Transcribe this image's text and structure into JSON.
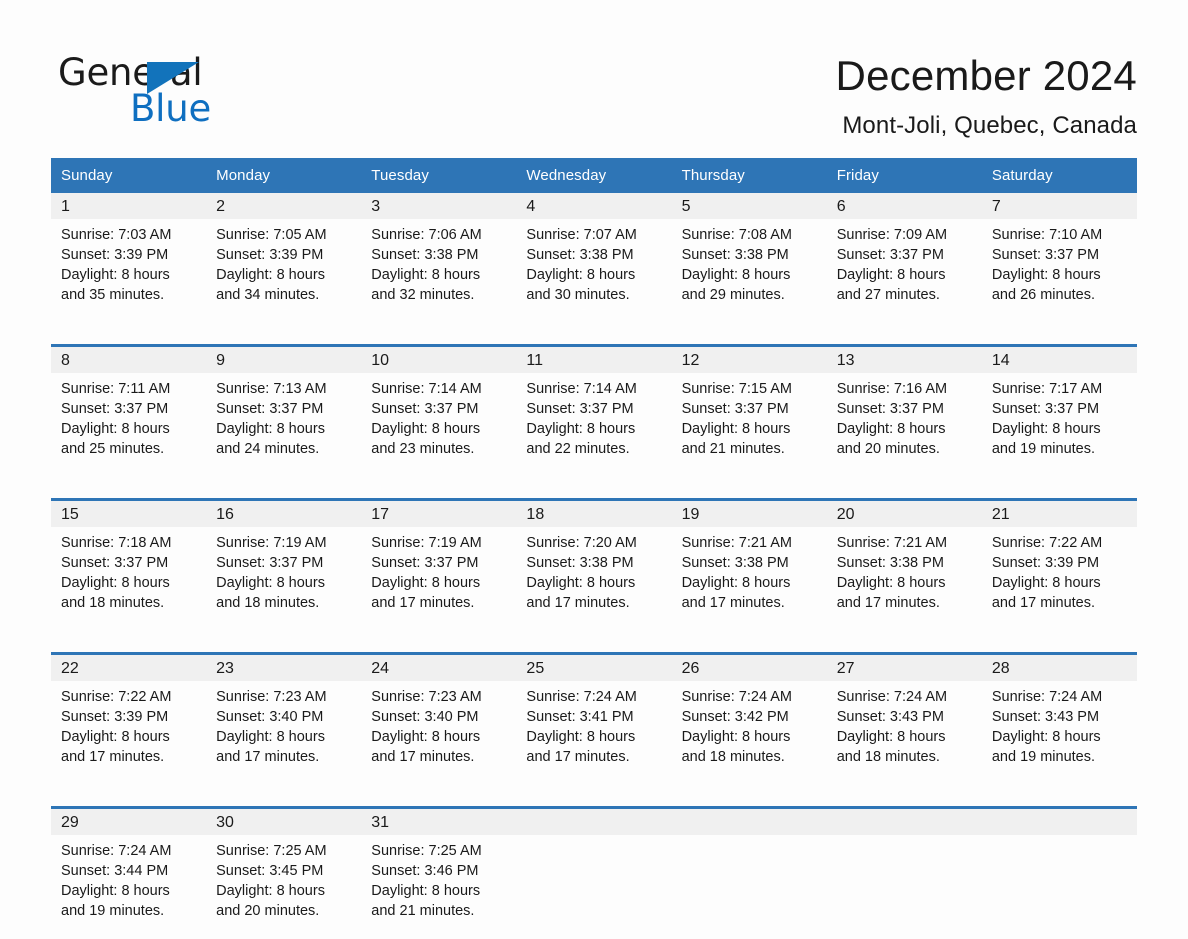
{
  "brand": {
    "name_part1": "General",
    "name_part2": "Blue"
  },
  "header": {
    "month_title": "December 2024",
    "location": "Mont-Joli, Quebec, Canada"
  },
  "colors": {
    "header_blue": "#2e75b6",
    "logo_blue": "#0f6fc0",
    "daynum_band": "#f0f0f0",
    "page_background": "#fdfdfd",
    "text": "#1a1a1a"
  },
  "calendar": {
    "weekday_headers": [
      "Sunday",
      "Monday",
      "Tuesday",
      "Wednesday",
      "Thursday",
      "Friday",
      "Saturday"
    ],
    "weeks": [
      [
        {
          "day": "1",
          "sunrise": "Sunrise: 7:03 AM",
          "sunset": "Sunset: 3:39 PM",
          "daylight_line1": "Daylight: 8 hours",
          "daylight_line2": "and 35 minutes."
        },
        {
          "day": "2",
          "sunrise": "Sunrise: 7:05 AM",
          "sunset": "Sunset: 3:39 PM",
          "daylight_line1": "Daylight: 8 hours",
          "daylight_line2": "and 34 minutes."
        },
        {
          "day": "3",
          "sunrise": "Sunrise: 7:06 AM",
          "sunset": "Sunset: 3:38 PM",
          "daylight_line1": "Daylight: 8 hours",
          "daylight_line2": "and 32 minutes."
        },
        {
          "day": "4",
          "sunrise": "Sunrise: 7:07 AM",
          "sunset": "Sunset: 3:38 PM",
          "daylight_line1": "Daylight: 8 hours",
          "daylight_line2": "and 30 minutes."
        },
        {
          "day": "5",
          "sunrise": "Sunrise: 7:08 AM",
          "sunset": "Sunset: 3:38 PM",
          "daylight_line1": "Daylight: 8 hours",
          "daylight_line2": "and 29 minutes."
        },
        {
          "day": "6",
          "sunrise": "Sunrise: 7:09 AM",
          "sunset": "Sunset: 3:37 PM",
          "daylight_line1": "Daylight: 8 hours",
          "daylight_line2": "and 27 minutes."
        },
        {
          "day": "7",
          "sunrise": "Sunrise: 7:10 AM",
          "sunset": "Sunset: 3:37 PM",
          "daylight_line1": "Daylight: 8 hours",
          "daylight_line2": "and 26 minutes."
        }
      ],
      [
        {
          "day": "8",
          "sunrise": "Sunrise: 7:11 AM",
          "sunset": "Sunset: 3:37 PM",
          "daylight_line1": "Daylight: 8 hours",
          "daylight_line2": "and 25 minutes."
        },
        {
          "day": "9",
          "sunrise": "Sunrise: 7:13 AM",
          "sunset": "Sunset: 3:37 PM",
          "daylight_line1": "Daylight: 8 hours",
          "daylight_line2": "and 24 minutes."
        },
        {
          "day": "10",
          "sunrise": "Sunrise: 7:14 AM",
          "sunset": "Sunset: 3:37 PM",
          "daylight_line1": "Daylight: 8 hours",
          "daylight_line2": "and 23 minutes."
        },
        {
          "day": "11",
          "sunrise": "Sunrise: 7:14 AM",
          "sunset": "Sunset: 3:37 PM",
          "daylight_line1": "Daylight: 8 hours",
          "daylight_line2": "and 22 minutes."
        },
        {
          "day": "12",
          "sunrise": "Sunrise: 7:15 AM",
          "sunset": "Sunset: 3:37 PM",
          "daylight_line1": "Daylight: 8 hours",
          "daylight_line2": "and 21 minutes."
        },
        {
          "day": "13",
          "sunrise": "Sunrise: 7:16 AM",
          "sunset": "Sunset: 3:37 PM",
          "daylight_line1": "Daylight: 8 hours",
          "daylight_line2": "and 20 minutes."
        },
        {
          "day": "14",
          "sunrise": "Sunrise: 7:17 AM",
          "sunset": "Sunset: 3:37 PM",
          "daylight_line1": "Daylight: 8 hours",
          "daylight_line2": "and 19 minutes."
        }
      ],
      [
        {
          "day": "15",
          "sunrise": "Sunrise: 7:18 AM",
          "sunset": "Sunset: 3:37 PM",
          "daylight_line1": "Daylight: 8 hours",
          "daylight_line2": "and 18 minutes."
        },
        {
          "day": "16",
          "sunrise": "Sunrise: 7:19 AM",
          "sunset": "Sunset: 3:37 PM",
          "daylight_line1": "Daylight: 8 hours",
          "daylight_line2": "and 18 minutes."
        },
        {
          "day": "17",
          "sunrise": "Sunrise: 7:19 AM",
          "sunset": "Sunset: 3:37 PM",
          "daylight_line1": "Daylight: 8 hours",
          "daylight_line2": "and 17 minutes."
        },
        {
          "day": "18",
          "sunrise": "Sunrise: 7:20 AM",
          "sunset": "Sunset: 3:38 PM",
          "daylight_line1": "Daylight: 8 hours",
          "daylight_line2": "and 17 minutes."
        },
        {
          "day": "19",
          "sunrise": "Sunrise: 7:21 AM",
          "sunset": "Sunset: 3:38 PM",
          "daylight_line1": "Daylight: 8 hours",
          "daylight_line2": "and 17 minutes."
        },
        {
          "day": "20",
          "sunrise": "Sunrise: 7:21 AM",
          "sunset": "Sunset: 3:38 PM",
          "daylight_line1": "Daylight: 8 hours",
          "daylight_line2": "and 17 minutes."
        },
        {
          "day": "21",
          "sunrise": "Sunrise: 7:22 AM",
          "sunset": "Sunset: 3:39 PM",
          "daylight_line1": "Daylight: 8 hours",
          "daylight_line2": "and 17 minutes."
        }
      ],
      [
        {
          "day": "22",
          "sunrise": "Sunrise: 7:22 AM",
          "sunset": "Sunset: 3:39 PM",
          "daylight_line1": "Daylight: 8 hours",
          "daylight_line2": "and 17 minutes."
        },
        {
          "day": "23",
          "sunrise": "Sunrise: 7:23 AM",
          "sunset": "Sunset: 3:40 PM",
          "daylight_line1": "Daylight: 8 hours",
          "daylight_line2": "and 17 minutes."
        },
        {
          "day": "24",
          "sunrise": "Sunrise: 7:23 AM",
          "sunset": "Sunset: 3:40 PM",
          "daylight_line1": "Daylight: 8 hours",
          "daylight_line2": "and 17 minutes."
        },
        {
          "day": "25",
          "sunrise": "Sunrise: 7:24 AM",
          "sunset": "Sunset: 3:41 PM",
          "daylight_line1": "Daylight: 8 hours",
          "daylight_line2": "and 17 minutes."
        },
        {
          "day": "26",
          "sunrise": "Sunrise: 7:24 AM",
          "sunset": "Sunset: 3:42 PM",
          "daylight_line1": "Daylight: 8 hours",
          "daylight_line2": "and 18 minutes."
        },
        {
          "day": "27",
          "sunrise": "Sunrise: 7:24 AM",
          "sunset": "Sunset: 3:43 PM",
          "daylight_line1": "Daylight: 8 hours",
          "daylight_line2": "and 18 minutes."
        },
        {
          "day": "28",
          "sunrise": "Sunrise: 7:24 AM",
          "sunset": "Sunset: 3:43 PM",
          "daylight_line1": "Daylight: 8 hours",
          "daylight_line2": "and 19 minutes."
        }
      ],
      [
        {
          "day": "29",
          "sunrise": "Sunrise: 7:24 AM",
          "sunset": "Sunset: 3:44 PM",
          "daylight_line1": "Daylight: 8 hours",
          "daylight_line2": "and 19 minutes."
        },
        {
          "day": "30",
          "sunrise": "Sunrise: 7:25 AM",
          "sunset": "Sunset: 3:45 PM",
          "daylight_line1": "Daylight: 8 hours",
          "daylight_line2": "and 20 minutes."
        },
        {
          "day": "31",
          "sunrise": "Sunrise: 7:25 AM",
          "sunset": "Sunset: 3:46 PM",
          "daylight_line1": "Daylight: 8 hours",
          "daylight_line2": "and 21 minutes."
        },
        {
          "day": "",
          "sunrise": "",
          "sunset": "",
          "daylight_line1": "",
          "daylight_line2": ""
        },
        {
          "day": "",
          "sunrise": "",
          "sunset": "",
          "daylight_line1": "",
          "daylight_line2": ""
        },
        {
          "day": "",
          "sunrise": "",
          "sunset": "",
          "daylight_line1": "",
          "daylight_line2": ""
        },
        {
          "day": "",
          "sunrise": "",
          "sunset": "",
          "daylight_line1": "",
          "daylight_line2": ""
        }
      ]
    ]
  }
}
